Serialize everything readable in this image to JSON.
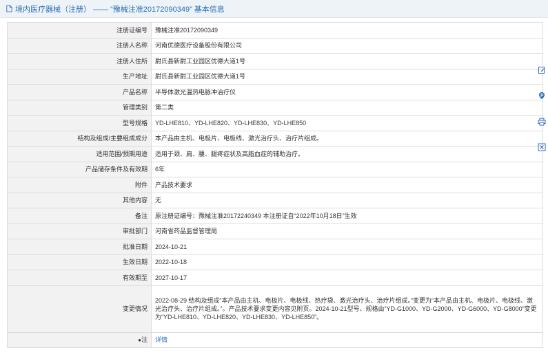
{
  "header": {
    "title": "境内医疗器械（注册） —— “豫械注准20172090349” 基本信息"
  },
  "rows": [
    {
      "label": "注册证编号",
      "value": "豫械注准20172090349"
    },
    {
      "label": "注册人名称",
      "value": "河南优德医疗设备股份有限公司"
    },
    {
      "label": "注册人住所",
      "value": "尉氏县新尉工业园区优德大道1号"
    },
    {
      "label": "生产地址",
      "value": "尉氏县新尉工业园区优德大道1号"
    },
    {
      "label": "产品名称",
      "value": "半导体激光温热电脉冲治疗仪"
    },
    {
      "label": "管理类别",
      "value": "第二类"
    },
    {
      "label": "型号规格",
      "value": "YD-LHE810、YD-LHE820、YD-LHE830、YD-LHE850"
    },
    {
      "label": "结构及组成/主要组成成分",
      "value": "本产品由主机、电极片、电极线、激光治疗头、治疗片组成。"
    },
    {
      "label": "适用范围/预期用途",
      "value": "适用于颈、肩、腰、腿疼症状及高脂血症的辅助治疗。"
    },
    {
      "label": "产品储存条件及有效期",
      "value": "6年"
    },
    {
      "label": "附件",
      "value": "产品技术要求"
    },
    {
      "label": "其他内容",
      "value": "无"
    },
    {
      "label": "备注",
      "value": "原注册证编号：豫械注准20172240349 本注册证自“2022年10月18日”生效"
    },
    {
      "label": "审批部门",
      "value": "河南省药品监督管理局"
    },
    {
      "label": "批准日期",
      "value": "2024-10-21"
    },
    {
      "label": "生效日期",
      "value": "2022-10-18"
    },
    {
      "label": "有效期至",
      "value": "2027-10-17"
    },
    {
      "label": "变更情况",
      "value": "2022-08-29 结构及组成“本产品由主机、电极片、电极线、热疗袋、激光治疗头、治疗片组成。”变更为“本产品由主机、电极片、电极线、激光治疗头、治疗片组成。”。产品技术要求变更内容见附页。2024-10-21型号、规格由“YD-G1000、YD-G2000、YD-G6000、YD-G8000”变更为“YD-LHE810、YD-LHE820、YD-LHE830、YD-LHE850”。"
    },
    {
      "label": "注",
      "value": "详情"
    }
  ],
  "side_toolbar": {
    "icons": [
      "edit-icon",
      "feedback-icon",
      "print-icon",
      "close-icon"
    ],
    "accent": "#2a6fb6"
  }
}
